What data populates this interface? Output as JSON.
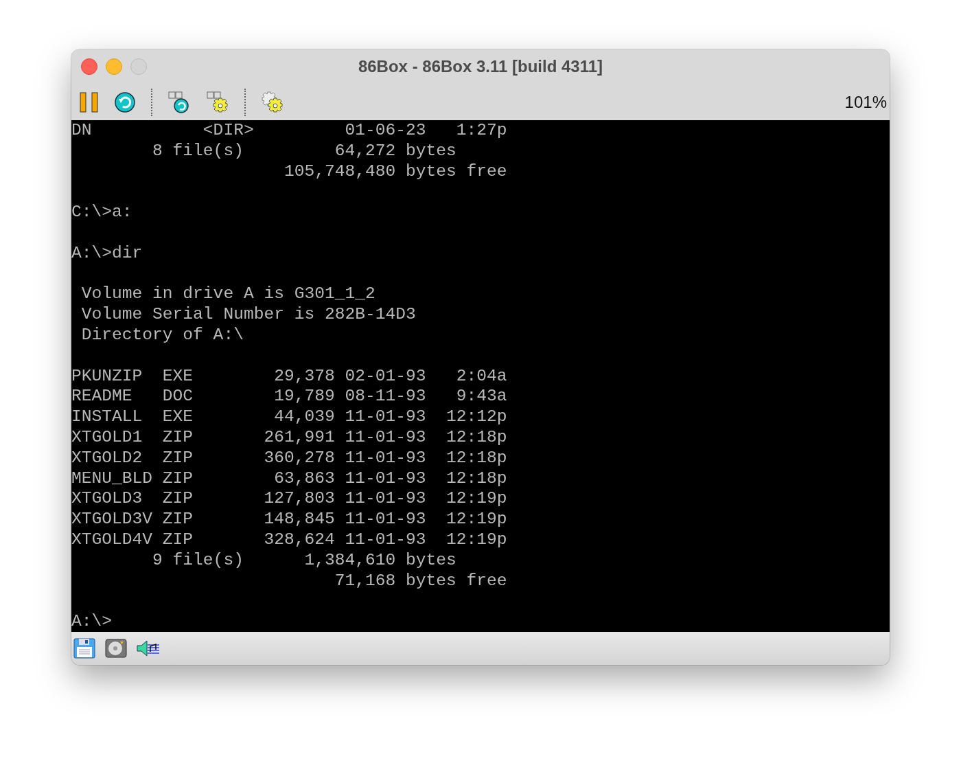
{
  "window": {
    "title": "86Box - 86Box 3.11 [build 4311]"
  },
  "toolbar": {
    "zoom": "101%"
  },
  "console": {
    "blocks": [
      {
        "lines": [
          "DN           <DIR>         01-06-23   1:27p",
          "        8 file(s)         64,272 bytes",
          "                     105,748,480 bytes free"
        ]
      },
      {
        "lines": [
          "C:\\>a:"
        ]
      },
      {
        "lines": [
          "A:\\>dir"
        ]
      },
      {
        "lines": [
          " Volume in drive A is G301_1_2",
          " Volume Serial Number is 282B-14D3",
          " Directory of A:\\"
        ]
      },
      {
        "lines": [
          "PKUNZIP  EXE        29,378 02-01-93   2:04a",
          "README   DOC        19,789 08-11-93   9:43a",
          "INSTALL  EXE        44,039 11-01-93  12:12p",
          "XTGOLD1  ZIP       261,991 11-01-93  12:18p",
          "XTGOLD2  ZIP       360,278 11-01-93  12:18p",
          "MENU_BLD ZIP        63,863 11-01-93  12:18p",
          "XTGOLD3  ZIP       127,803 11-01-93  12:19p",
          "XTGOLD3V ZIP       148,845 11-01-93  12:19p",
          "XTGOLD4V ZIP       328,624 11-01-93  12:19p",
          "        9 file(s)      1,384,610 bytes",
          "                          71,168 bytes free"
        ]
      },
      {
        "lines": [
          "A:\\>"
        ]
      }
    ]
  }
}
